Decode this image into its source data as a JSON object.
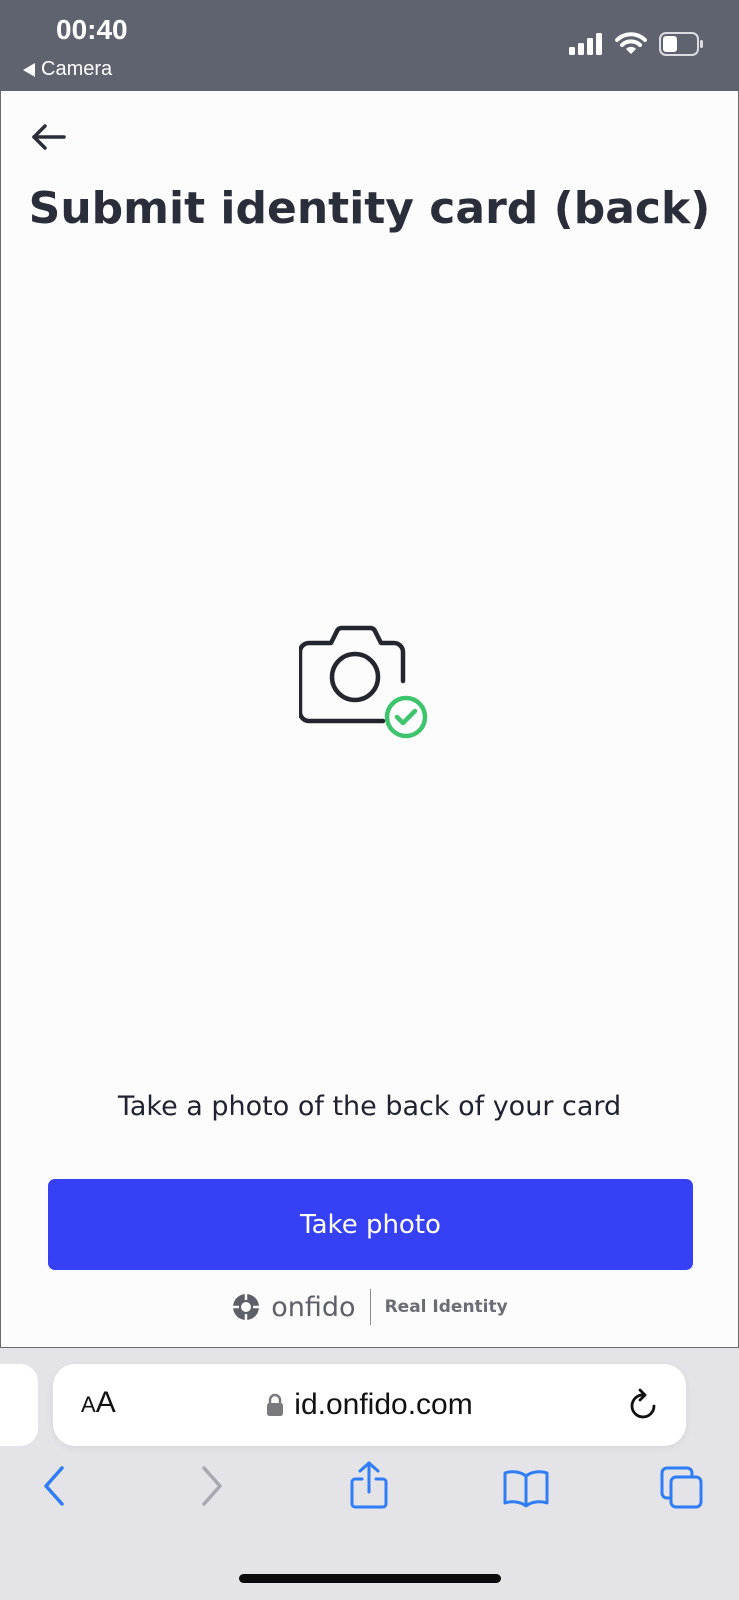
{
  "status_bar": {
    "time": "00:40",
    "back_app": "Camera",
    "icons": [
      "signal-icon",
      "wifi-icon",
      "battery-icon"
    ]
  },
  "page": {
    "title": "Submit identity card (back)",
    "instruction": "Take a photo of the back of your card",
    "primary_button": "Take photo",
    "brand_name": "onfido",
    "brand_tagline": "Real Identity",
    "accent_color": "#3640F5",
    "success_color": "#3EC46D"
  },
  "browser": {
    "text_size_small": "A",
    "text_size_big": "A",
    "url": "id.onfido.com",
    "toolbar_icons": [
      "back-icon",
      "forward-icon",
      "share-icon",
      "bookmarks-icon",
      "tabs-icon"
    ]
  }
}
